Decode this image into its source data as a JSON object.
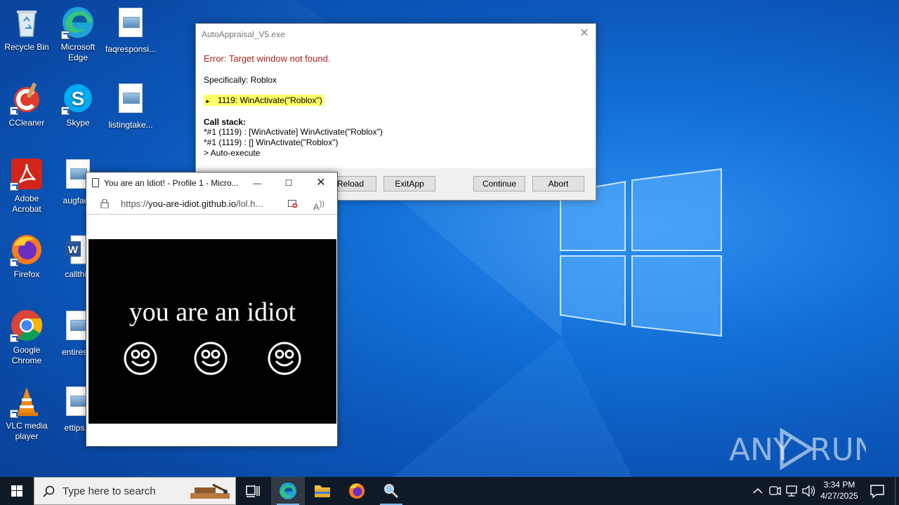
{
  "desktop": {
    "icons": [
      {
        "label": "Recycle Bin"
      },
      {
        "label": "Microsoft Edge"
      },
      {
        "label": "faqresponsi..."
      },
      {
        "label": "CCleaner"
      },
      {
        "label": "Skype"
      },
      {
        "label": "listingtake..."
      },
      {
        "label": "Adobe Acrobat"
      },
      {
        "label": "augfacu"
      },
      {
        "label": "Firefox"
      },
      {
        "label": "callthin"
      },
      {
        "label": "Google Chrome"
      },
      {
        "label": "entireset"
      },
      {
        "label": "VLC media player"
      },
      {
        "label": "ettips.p"
      }
    ]
  },
  "dialog": {
    "title": "AutoAppraisal_V5.exe",
    "error": "Error: Target window not found.",
    "specifically": "Specifically: Roblox",
    "highlight_line": "1119: WinActivate(\"Roblox\")",
    "callstack_title": "Call stack:",
    "callstack": [
      "*#1 (1119) : [WinActivate] WinActivate(\"Roblox\")",
      "*#1 (1119) : [] WinActivate(\"Roblox\")",
      "> Auto-execute"
    ],
    "buttons": {
      "reload": "Reload",
      "exitapp": "ExitApp",
      "continue": "Continue",
      "abort": "Abort"
    }
  },
  "browser": {
    "title": "You are an Idiot! - Profile 1 - Micro...",
    "url_prefix": "https://",
    "url_host": "you-are-idiot.github.io",
    "url_path": "/lol.h...",
    "page_text": "you are an idiot"
  },
  "taskbar": {
    "search_placeholder": "Type here to search",
    "time": "3:34 PM",
    "date": "4/27/2025"
  },
  "watermark": "ANY RUN",
  "colors": {
    "error_text": "#a22222",
    "highlight": "#ffff66",
    "taskbar": "#101a26"
  }
}
